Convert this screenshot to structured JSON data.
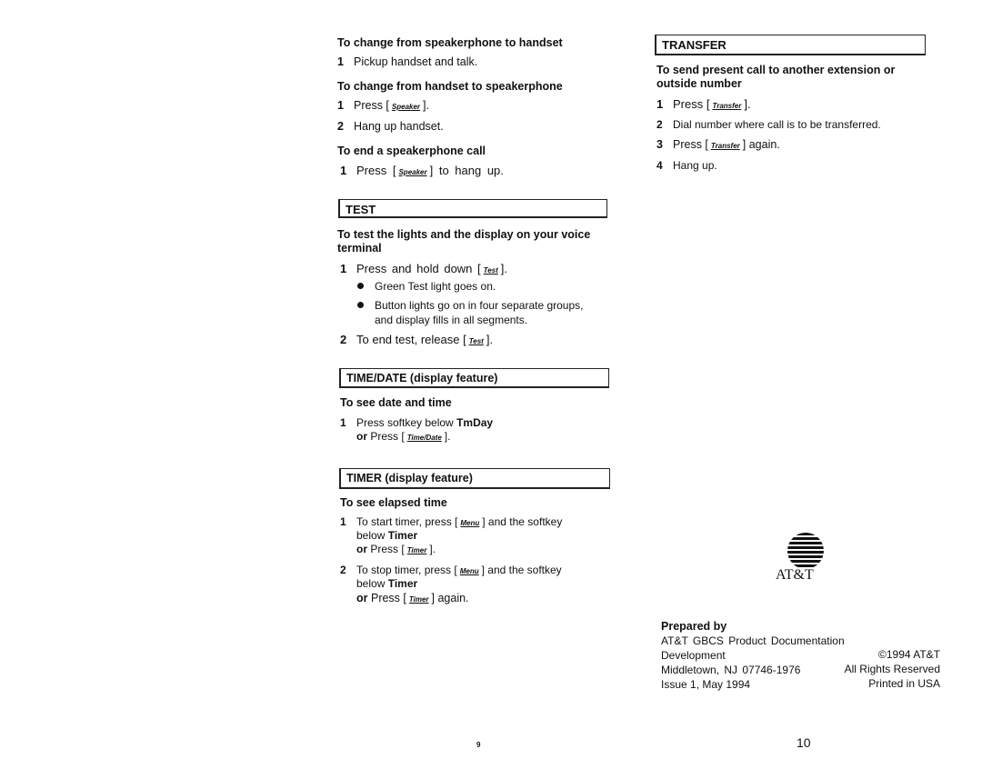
{
  "left": {
    "h1": "To change from speakerphone to handset",
    "s1": {
      "n": "1",
      "text": "Pickup handset and talk."
    },
    "h2": "To change from handset to speakerphone",
    "s2": {
      "n": "1",
      "pre": "Press [",
      "key": "Speaker",
      "post": "]."
    },
    "s3": {
      "n": "2",
      "text": "Hang up handset."
    },
    "h3": "To end a speakerphone call",
    "s4": {
      "n": "1",
      "pre": "Press [",
      "key": "Speaker",
      "post": "] to hang up."
    },
    "test": {
      "title": "TEST",
      "heading": "To test the lights and the display on your voice",
      "heading2": "terminal",
      "s1": {
        "n": "1",
        "pre": "Press and hold down [",
        "key": "Test",
        "post": "]."
      },
      "b1": "Green Test light goes on.",
      "b2": "Button lights go on in four separate groups,",
      "b2b": "and display fills in all segments.",
      "s2": {
        "n": "2",
        "pre": "To end test, release [",
        "key": "Test",
        "post": "]."
      }
    },
    "timedate": {
      "title": "TIME/DATE (display feature)",
      "heading": "To see date and time",
      "s1": {
        "n": "1",
        "pre": "Press softkey below",
        "bold": "TmDay"
      },
      "s1b": {
        "or": "or",
        "pre": "Press [",
        "key": "Time/Date",
        "post": "]."
      }
    },
    "timer": {
      "title": "TIMER (display feature)",
      "heading": "To see elapsed time",
      "s1": {
        "n": "1",
        "pre": "To start timer, press [",
        "key": "Menu",
        "post": "] and the softkey"
      },
      "s1b": {
        "pre": "below",
        "bold": "Timer"
      },
      "s1c": {
        "or": "or",
        "pre": "Press [",
        "key": "Timer",
        "post": "]."
      },
      "s2": {
        "n": "2",
        "pre": "To stop timer, press [",
        "key": "Menu",
        "post": "] and the softkey"
      },
      "s2b": {
        "pre": "below",
        "bold": "Timer"
      },
      "s2c": {
        "or": "or",
        "pre": "Press [",
        "key": "Timer",
        "post": "] again."
      }
    },
    "page_number": "9"
  },
  "right": {
    "transfer": {
      "title": "TRANSFER",
      "heading": "To send present call to another extension or",
      "heading2": "outside number",
      "s1": {
        "n": "1",
        "pre": "Press [",
        "key": "Transfer",
        "post": "]."
      },
      "s2": {
        "n": "2",
        "text": "Dial number where call is to be transferred."
      },
      "s3": {
        "n": "3",
        "pre": "Press [",
        "key": "Transfer",
        "post": "] again."
      },
      "s4": {
        "n": "4",
        "text": "Hang up."
      }
    },
    "logo_text": "AT&T",
    "prepared": {
      "heading": "Prepared by",
      "l1": "AT&T GBCS Product Documentation",
      "l2": "Development",
      "l3": "Middletown, NJ 07746-1976",
      "l4": "Issue 1, May 1994",
      "r1": "©1994 AT&T",
      "r2": "All Rights Reserved",
      "r3": "Printed in USA"
    },
    "page_number": "10"
  }
}
